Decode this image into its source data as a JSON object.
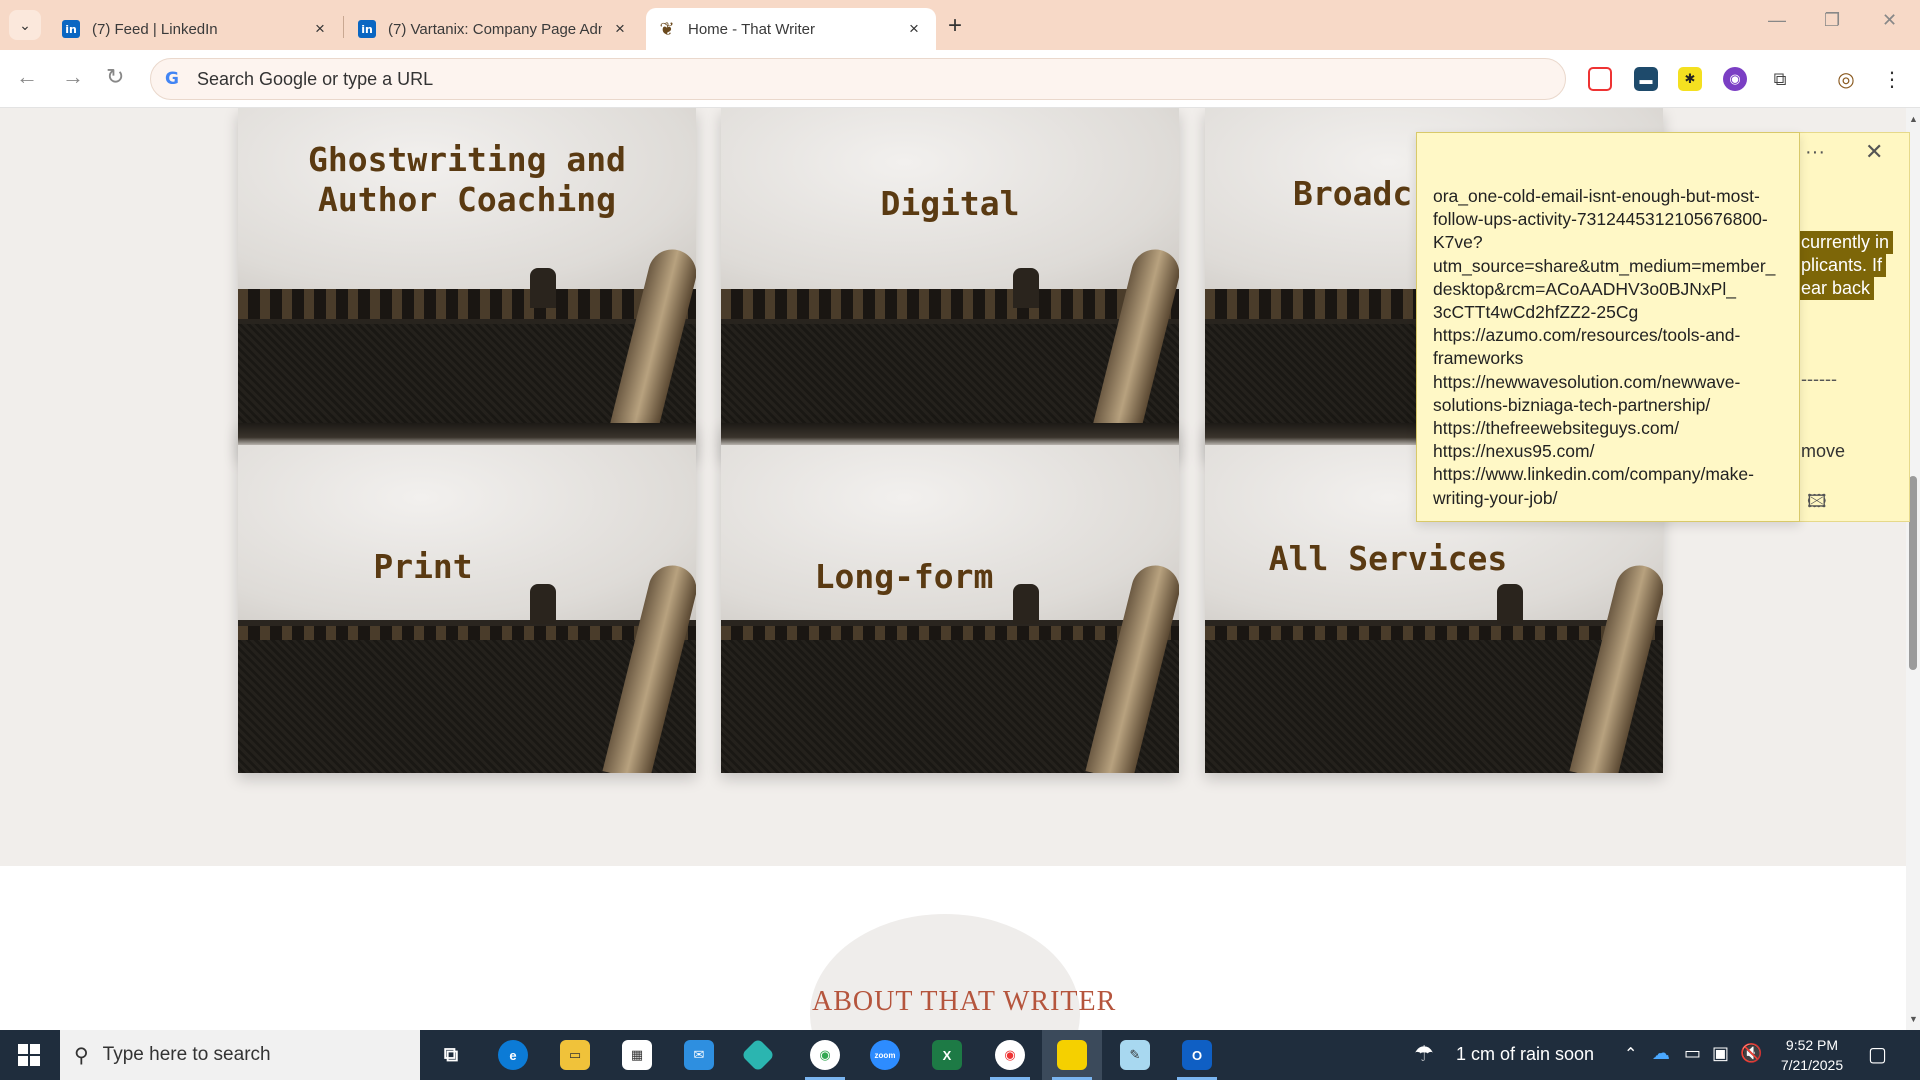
{
  "browser": {
    "tabs": [
      {
        "title": "(7) Feed | LinkedIn",
        "favicon": "linkedin-icon",
        "active": false
      },
      {
        "title": "(7) Vartanix: Company Page Adm",
        "favicon": "linkedin-icon",
        "active": false
      },
      {
        "title": "Home - That Writer",
        "favicon": "quill-icon",
        "active": true
      }
    ],
    "omnibox_placeholder": "Search Google or type a URL"
  },
  "services": [
    {
      "label": "Ghostwriting and\nAuthor Coaching"
    },
    {
      "label": "Digital"
    },
    {
      "label": "Broadc"
    },
    {
      "label": "Print"
    },
    {
      "label": "Long-form"
    },
    {
      "label": "All Services"
    }
  ],
  "about_heading": "ABOUT THAT WRITER",
  "sticky_note": {
    "lines": [
      "ora_one-cold-email-isnt-enough-but-most-",
      "follow-ups-activity-7312445312105676800-",
      "K7ve?",
      "utm_source=share&utm_medium=member_",
      "desktop&rcm=ACoAADHV3o0BJNxPl_",
      "3cCTTt4wCd2hfZZ2-25Cg",
      "https://azumo.com/resources/tools-and-",
      "frameworks",
      "https://newwavesolution.com/newwave-",
      "solutions-bizniaga-tech-partnership/",
      "https://thefreewebsiteguys.com/",
      "https://nexus95.com/",
      "https://www.linkedin.com/company/make-",
      "writing-your-job/"
    ],
    "back_highlights": [
      "currently in",
      "plicants. If",
      "ear back"
    ],
    "back_dash": "------",
    "back_move": "move"
  },
  "taskbar": {
    "search_placeholder": "Type here to search",
    "weather": "1 cm of rain soon",
    "time": "9:52 PM",
    "date": "7/21/2025"
  },
  "colors": {
    "tabbar": "#f7d9c7",
    "label_brown": "#5a3a12",
    "sticky_yellow": "#fff8c6",
    "taskbar": "#1f2d3d"
  }
}
